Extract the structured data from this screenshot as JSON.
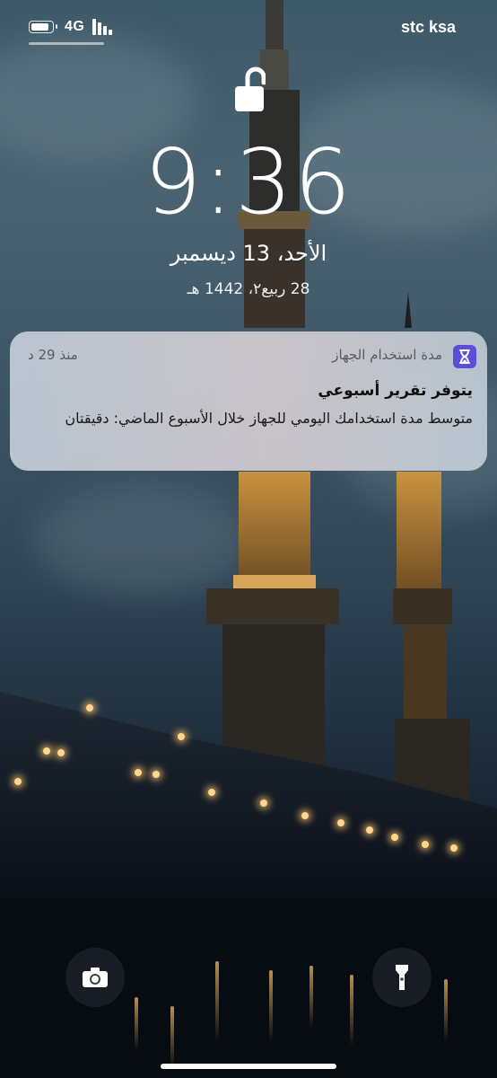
{
  "status_bar": {
    "network": "4G",
    "carrier": "stc ksa",
    "battery_level": 0.9,
    "battery_icon": "battery-icon",
    "signal_icon": "signal-icon"
  },
  "lock_screen": {
    "lock_state_icon": "unlocked-padlock-icon",
    "time": "9:36",
    "date": "الأحد، 13 ديسمبر",
    "hijri_date": "28 ربيع٢، 1442 هـ"
  },
  "notification": {
    "app_icon": "hourglass-icon",
    "app_name": "مدة استخدام الجهاز",
    "time_ago": "منذ 29 د",
    "title": "يتوفر تقرير أسبوعي",
    "body": "متوسط مدة استخدامك اليومي للجهاز خلال الأسبوع الماضي: دقيقتان",
    "app_icon_color": "#5b4dd6"
  },
  "quick_actions": {
    "camera_icon": "camera-icon",
    "flashlight_icon": "flashlight-icon"
  }
}
